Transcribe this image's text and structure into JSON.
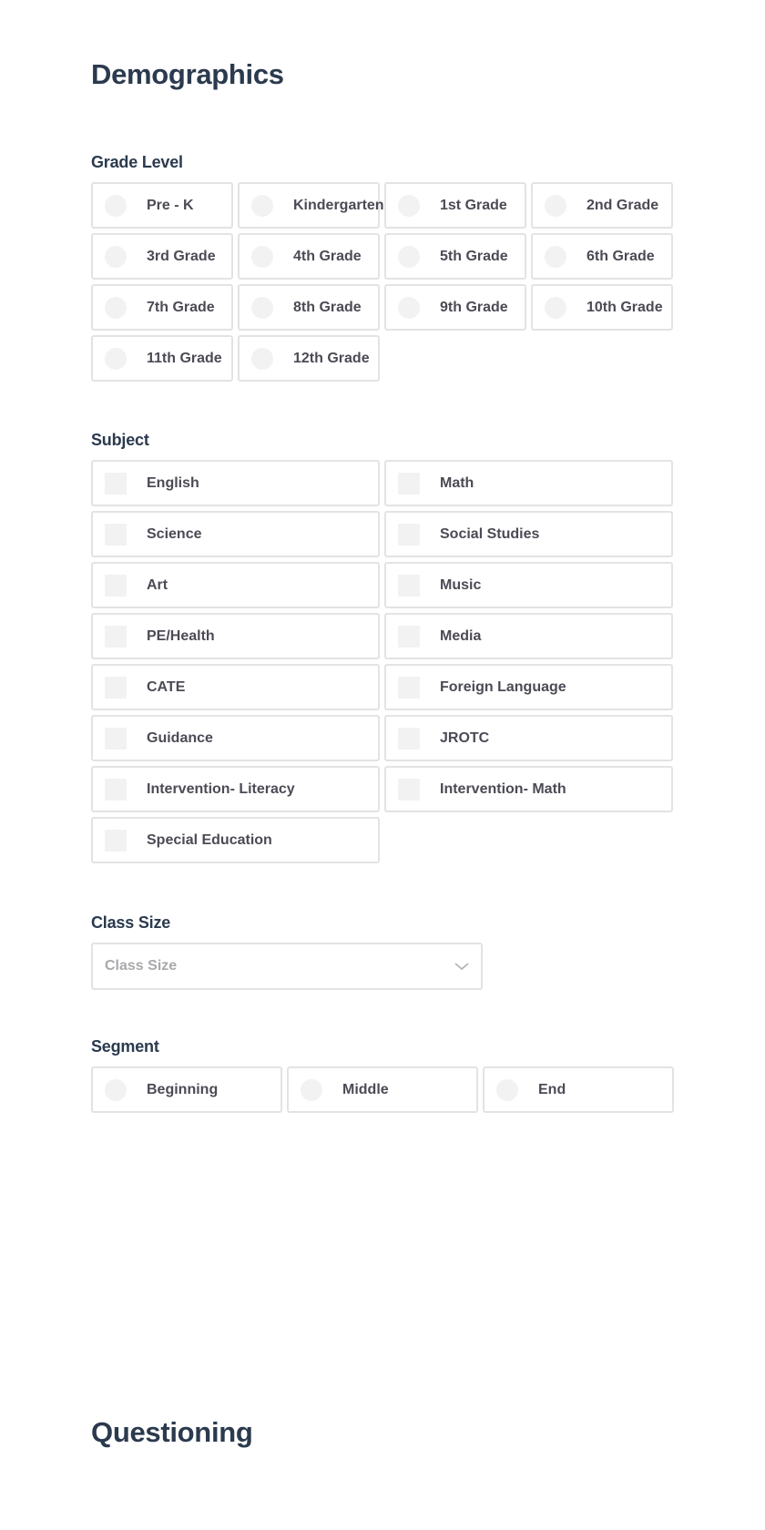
{
  "demographics": {
    "title": "Demographics",
    "grade_level": {
      "label": "Grade Level",
      "options": [
        "Pre - K",
        "Kindergarten",
        "1st Grade",
        "2nd Grade",
        "3rd Grade",
        "4th Grade",
        "5th Grade",
        "6th Grade",
        "7th Grade",
        "8th Grade",
        "9th Grade",
        "10th Grade",
        "11th Grade",
        "12th Grade"
      ]
    },
    "subject": {
      "label": "Subject",
      "options": [
        "English",
        "Math",
        "Science",
        "Social Studies",
        "Art",
        "Music",
        "PE/Health",
        "Media",
        "CATE",
        "Foreign Language",
        "Guidance",
        "JROTC",
        "Intervention- Literacy",
        "Intervention- Math",
        "Special Education"
      ]
    },
    "class_size": {
      "label": "Class Size",
      "placeholder": "Class Size",
      "icon": "chevron-down-icon"
    },
    "segment": {
      "label": "Segment",
      "options": [
        "Beginning",
        "Middle",
        "End"
      ]
    }
  },
  "questioning": {
    "title": "Questioning"
  }
}
